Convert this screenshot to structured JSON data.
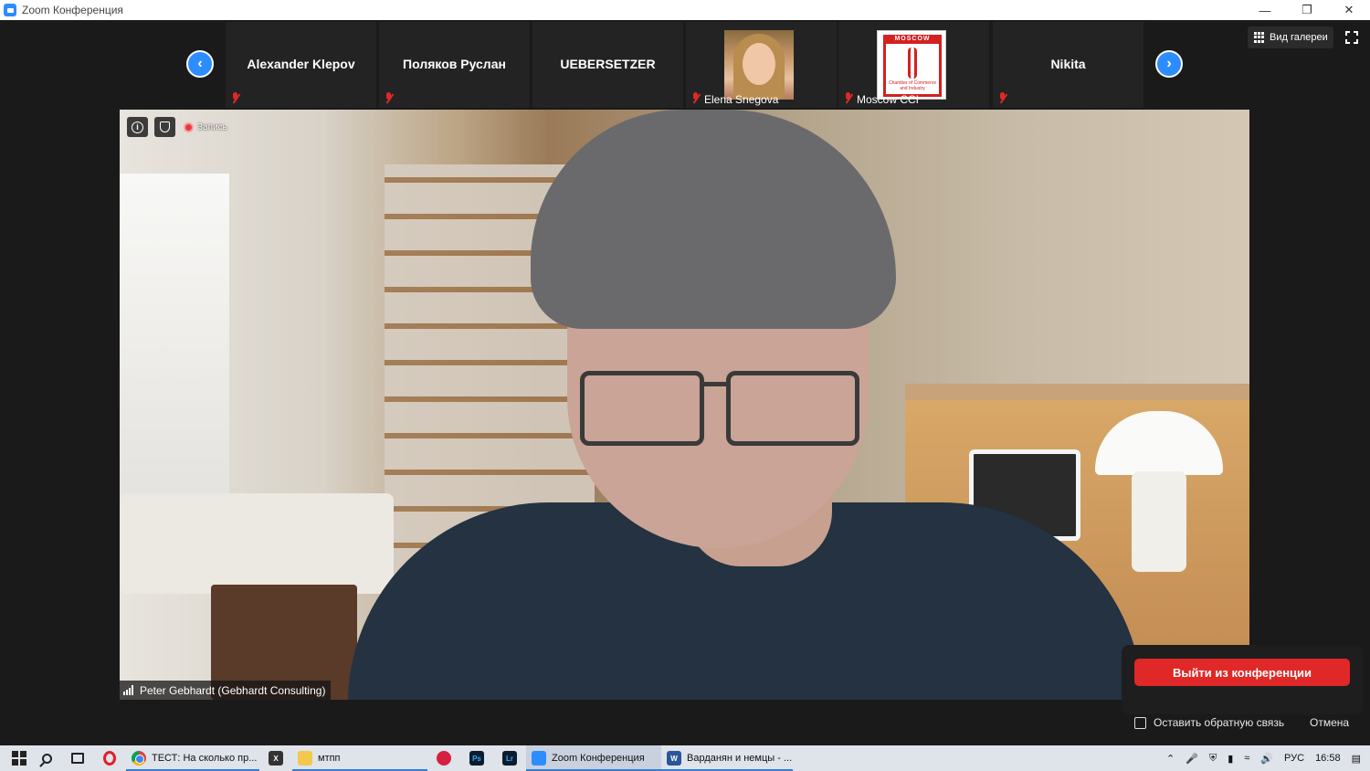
{
  "window": {
    "title": "Zoom Конференция",
    "controls": [
      "minimize",
      "restore",
      "close"
    ]
  },
  "gallery": {
    "tiles": [
      {
        "name": "Alexander Klepov",
        "show_name_center": true,
        "muted": true,
        "label": ""
      },
      {
        "name": "Поляков Руслан",
        "show_name_center": true,
        "muted": true,
        "label": ""
      },
      {
        "name": "UEBERSETZER",
        "show_name_center": true,
        "muted": false,
        "label": ""
      },
      {
        "name": "Elena Snegova",
        "show_name_center": false,
        "muted": true,
        "label": "Elena Snegova",
        "photo": "portrait"
      },
      {
        "name": "Moscow CCI",
        "show_name_center": false,
        "muted": true,
        "label": "Moscow CCI",
        "photo": "logo"
      },
      {
        "name": "Nikita",
        "show_name_center": true,
        "muted": true,
        "label": ""
      }
    ],
    "moscow_logo_text": "MOSCOW",
    "moscow_logo_sub": "Chamber of Commerce and Industry",
    "prev_icon": "chevron-left-icon",
    "next_icon": "chevron-right-icon"
  },
  "view": {
    "gallery_label": "Вид галереи",
    "fullscreen_icon": "fullscreen-icon"
  },
  "video": {
    "recording_label": "Запись",
    "speaker_name": "Peter Gebhardt (Gebhardt Consulting)"
  },
  "leave": {
    "button_label": "Выйти из конференции",
    "feedback_label": "Оставить обратную связь",
    "cancel_label": "Отмена"
  },
  "taskbar": {
    "apps": [
      {
        "label": "ТЕСТ: На сколько пр...",
        "icon": "chrome",
        "active": true
      },
      {
        "label": "",
        "icon": "app-x",
        "active": false
      },
      {
        "label": "мтпп",
        "icon": "folder",
        "active": true
      },
      {
        "label": "",
        "icon": "app-red",
        "active": false
      },
      {
        "label": "",
        "icon": "photoshop",
        "active": false
      },
      {
        "label": "",
        "icon": "lightroom",
        "active": false
      },
      {
        "label": "Zoom Конференция",
        "icon": "zoom",
        "active": true
      },
      {
        "label": "Варданян и немцы - ...",
        "icon": "word",
        "active": true
      }
    ],
    "tray": {
      "language": "РУС",
      "time": "16:58"
    }
  },
  "colors": {
    "accent": "#2d8cff",
    "danger": "#e02828",
    "background": "#1a1a1a"
  }
}
